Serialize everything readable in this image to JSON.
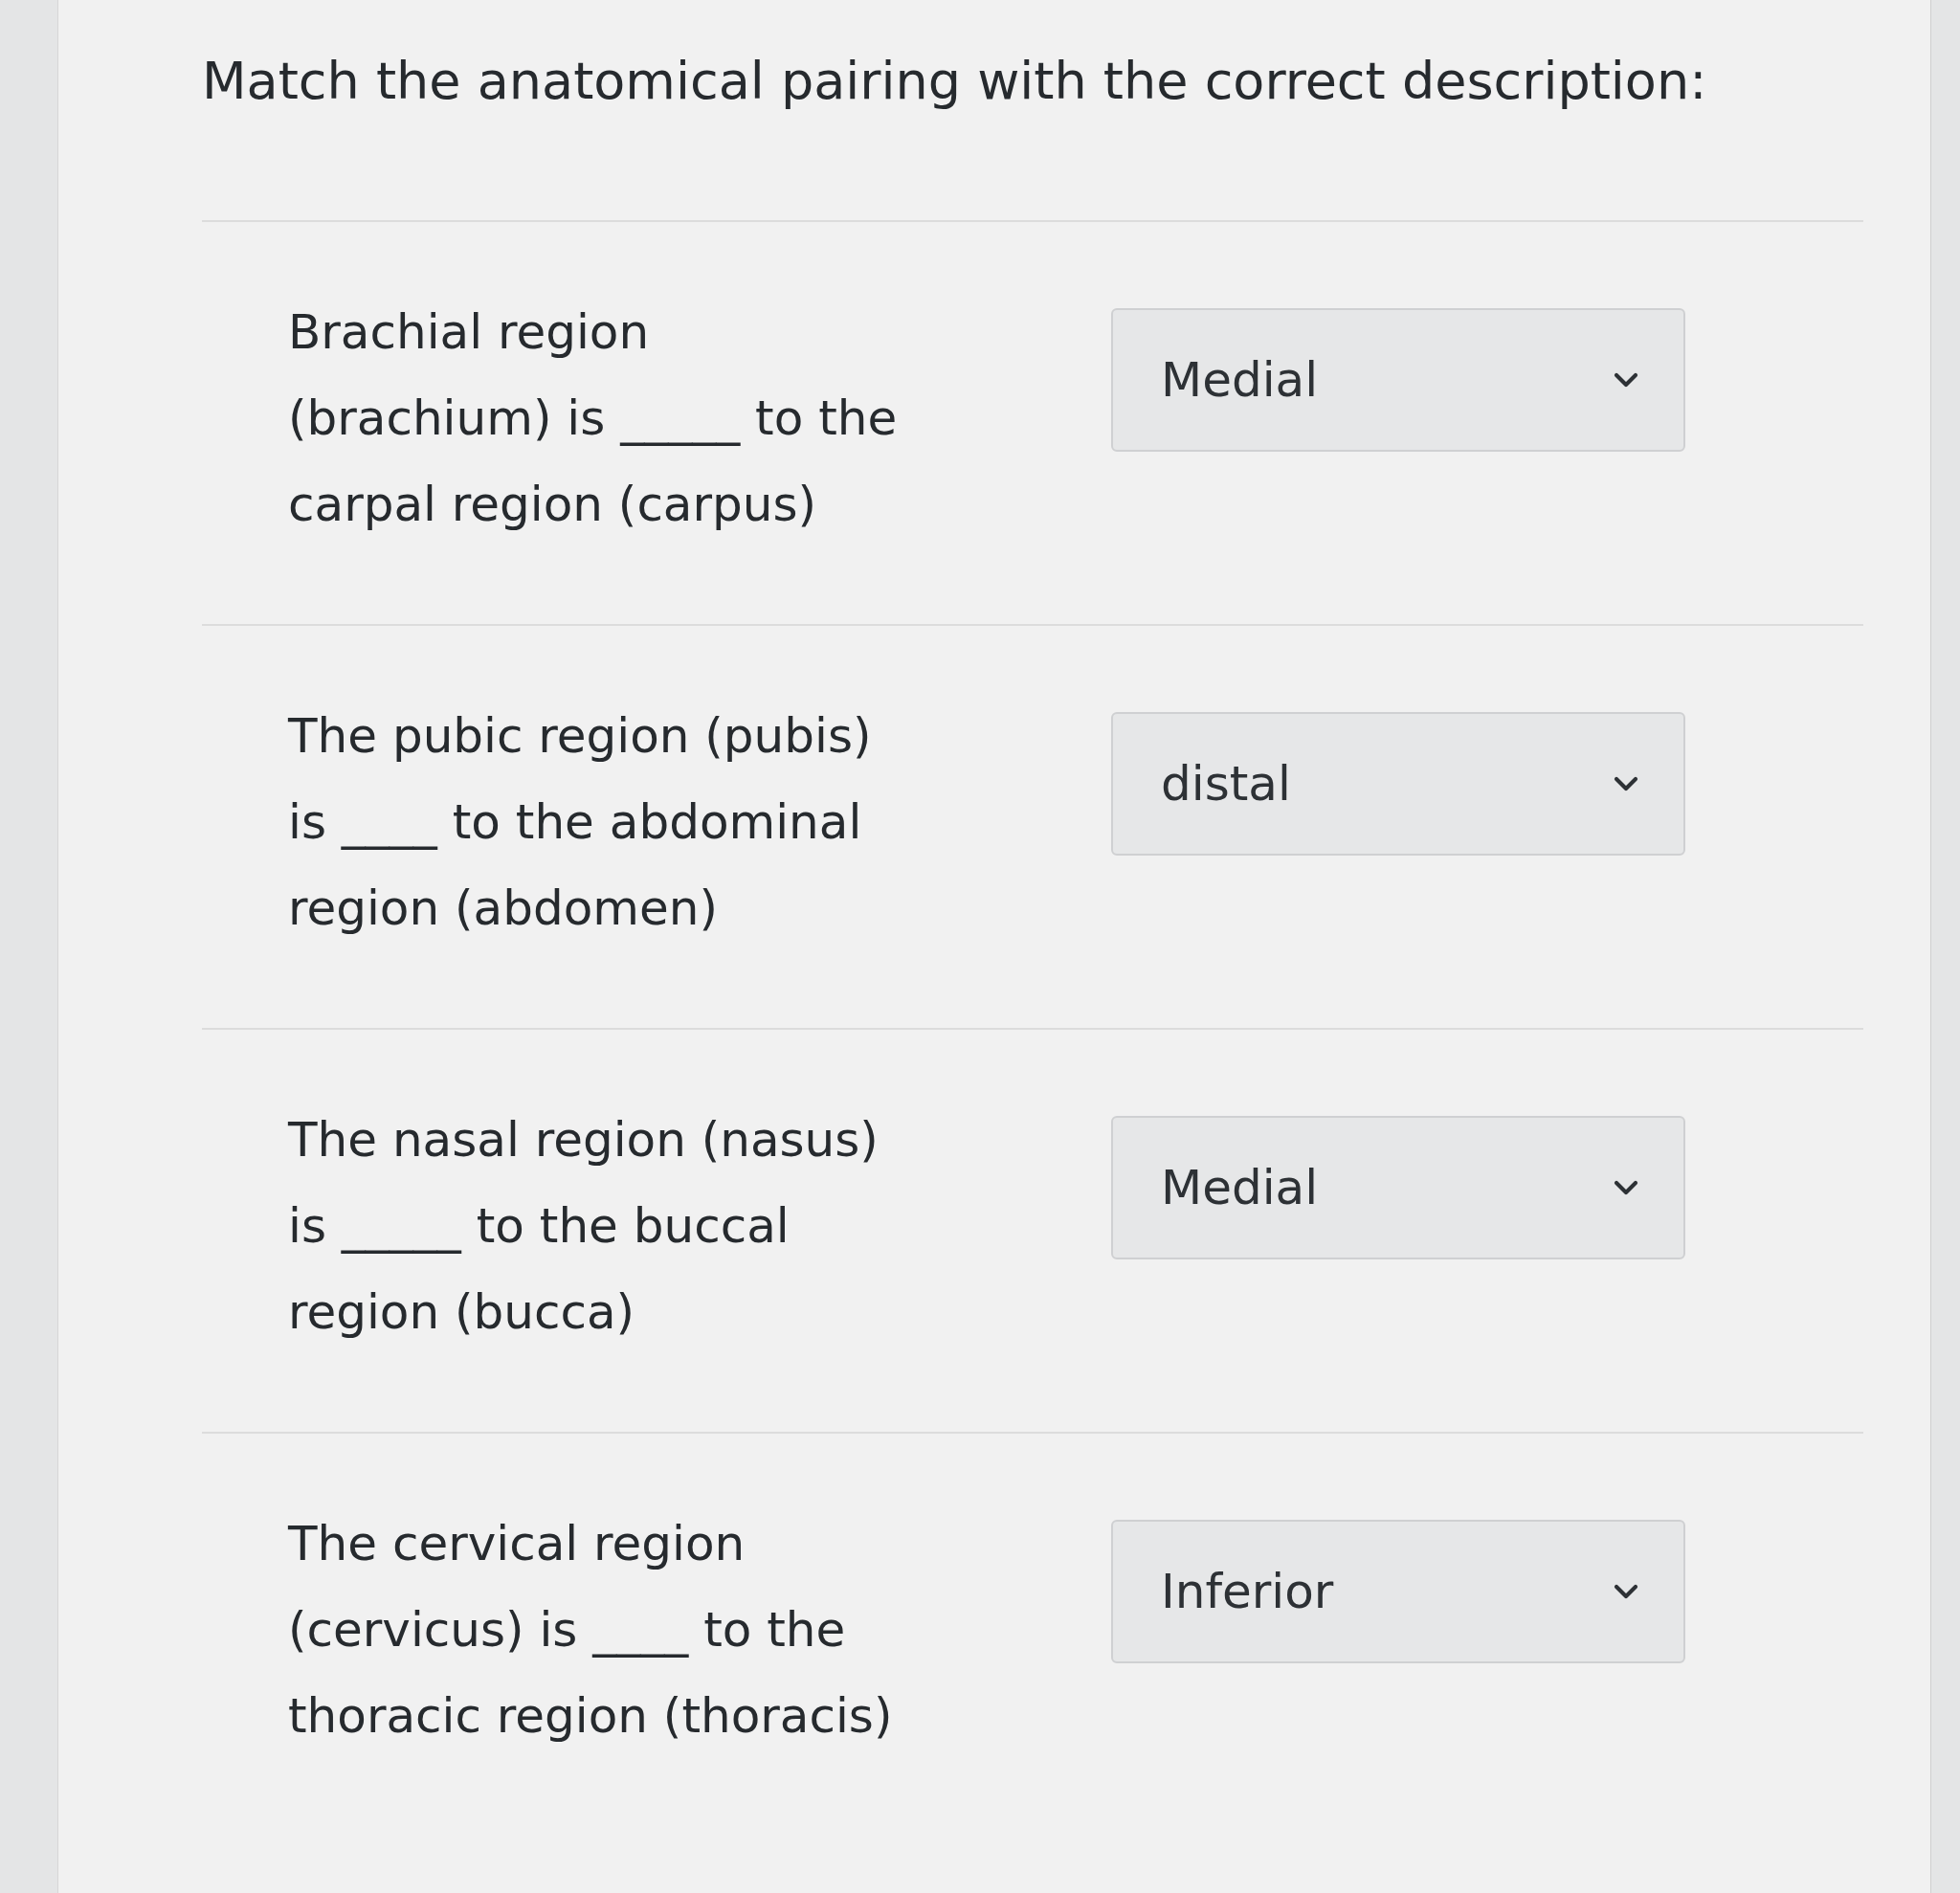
{
  "title": "Match the anatomical pairing with the correct description:",
  "questions": [
    {
      "text": "Brachial region (brachium) is _____ to the carpal region (carpus)",
      "answer": "Medial"
    },
    {
      "text": "The pubic region (pubis) is ____ to the abdominal region (abdomen)",
      "answer": "distal"
    },
    {
      "text": "The nasal region (nasus) is _____ to the buccal region (bucca)",
      "answer": "Medial"
    },
    {
      "text": "The cervical region (cervicus) is ____ to the thoracic region (thoracis)",
      "answer": "Inferior"
    }
  ]
}
